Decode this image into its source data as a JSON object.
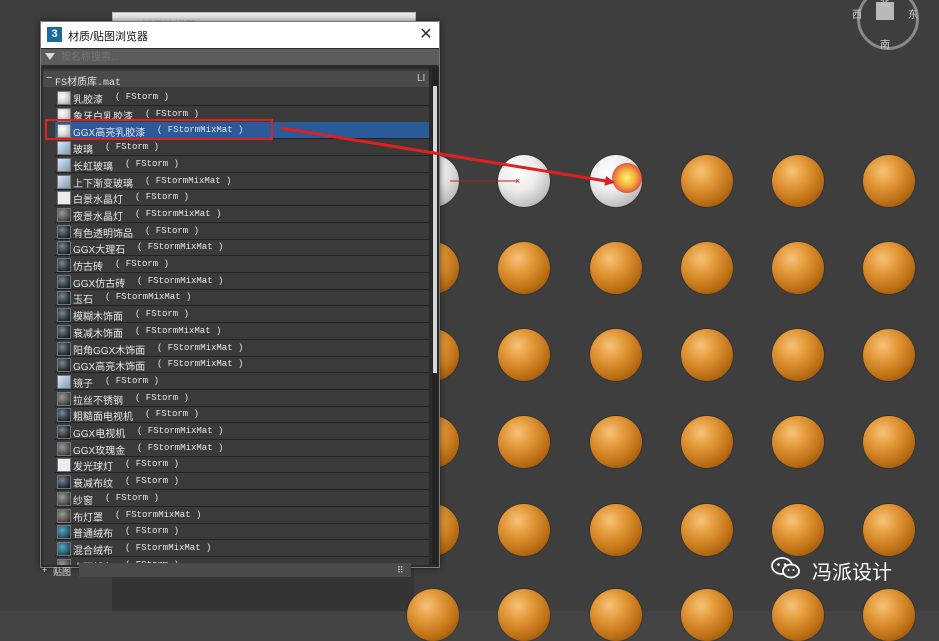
{
  "back_window": {
    "title": "材质编辑器 - 01 - Default"
  },
  "gizmo": {
    "labels": [
      "西",
      "北",
      "东",
      "南"
    ]
  },
  "dialog": {
    "title": "材质/贴图浏览器",
    "close_label": "✕",
    "search_placeholder": "按名称搜索...",
    "group_toggle": "−",
    "group_label": "FS材质库.mat",
    "group_tag": "LI",
    "items": [
      {
        "name": "乳胶漆",
        "type": "( FStorm )",
        "thumb": "w"
      },
      {
        "name": "象牙白乳胶漆",
        "type": "( FStorm )",
        "thumb": "w"
      },
      {
        "name": "GGX高亮乳胶漆",
        "type": "( FStormMixMat )",
        "thumb": "w",
        "selected": true
      },
      {
        "name": "玻璃",
        "type": "( FStorm )",
        "thumb": "g"
      },
      {
        "name": "长虹玻璃",
        "type": "( FStorm )",
        "thumb": "g"
      },
      {
        "name": "上下渐变玻璃",
        "type": "( FStormMixMat )",
        "thumb": "g"
      },
      {
        "name": "白景水晶灯",
        "type": "( FStorm )",
        "thumb": "p"
      },
      {
        "name": "夜景水晶灯",
        "type": "( FStormMixMat )",
        "thumb": "m"
      },
      {
        "name": "有色透明饰品",
        "type": "( FStorm )",
        "thumb": "d"
      },
      {
        "name": "GGX大理石",
        "type": "( FStormMixMat )",
        "thumb": "d"
      },
      {
        "name": "仿古砖",
        "type": "( FStorm )",
        "thumb": "d"
      },
      {
        "name": "GGX仿古砖",
        "type": "( FStormMixMat )",
        "thumb": "d"
      },
      {
        "name": "玉石",
        "type": "( FStormMixMat )",
        "thumb": "d"
      },
      {
        "name": "模糊木饰面",
        "type": "( FStorm )",
        "thumb": "d"
      },
      {
        "name": "衰减木饰面",
        "type": "( FStormMixMat )",
        "thumb": "d"
      },
      {
        "name": "阳角GGX木饰面",
        "type": "( FStormMixMat )",
        "thumb": "d"
      },
      {
        "name": "GGX高亮木饰面",
        "type": "( FStormMixMat )",
        "thumb": "d"
      },
      {
        "name": "镜子",
        "type": "( FStorm )",
        "thumb": "g"
      },
      {
        "name": "拉丝不锈钢",
        "type": "( FStorm )",
        "thumb": "m"
      },
      {
        "name": "粗糙面电视机",
        "type": "( FStorm )",
        "thumb": "d"
      },
      {
        "name": "GGX电视机",
        "type": "( FStormMixMat )",
        "thumb": "d"
      },
      {
        "name": "GGX玫瑰金",
        "type": "( FStormMixMat )",
        "thumb": "m"
      },
      {
        "name": "发光球灯",
        "type": "( FStorm )",
        "thumb": "p"
      },
      {
        "name": "衰减布纹",
        "type": "( FStorm )",
        "thumb": "d"
      },
      {
        "name": "纱窗",
        "type": "( FStorm )",
        "thumb": "m"
      },
      {
        "name": "布灯罩",
        "type": "( FStormMixMat )",
        "thumb": "m"
      },
      {
        "name": "普通绒布",
        "type": "( FStorm )",
        "thumb": "c"
      },
      {
        "name": "混合绒布",
        "type": "( FStormMixMat )",
        "thumb": "c"
      },
      {
        "name": "大面绒布",
        "type": "( FStorm )",
        "thumb": "m"
      }
    ],
    "footer_plus": "+",
    "footer_label": "贴图",
    "footer_right": "⠿"
  },
  "watermark": {
    "text": "冯派设计"
  },
  "colors": {
    "highlight": "#e02020",
    "selection": "#2b5a98",
    "sphere": "#d98a2a"
  }
}
